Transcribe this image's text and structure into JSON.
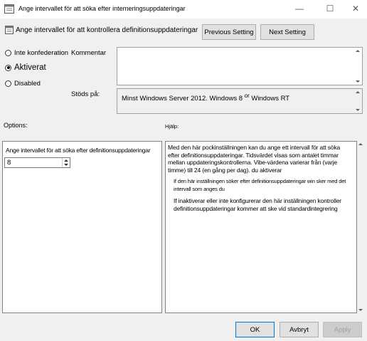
{
  "window": {
    "title": "Ange intervallet för att söka efter interneringsuppdateringar",
    "minimize": "—",
    "maximize": "☐",
    "close": "✕"
  },
  "header": {
    "setting_title": "Ange intervallet för att kontrollera definitionsuppdateringar",
    "previous_label": "Previous Setting",
    "next_label": "Next Setting"
  },
  "state": {
    "not_configured_label": "Inte konfederation",
    "enabled_label": "Aktiverat",
    "disabled_label": "Disabled",
    "selected": "enabled"
  },
  "comment": {
    "label": "Kommentar",
    "value": ""
  },
  "supported": {
    "label": "Stöds på:",
    "value_part1": "Minst Windows Server 2012. Windows 8",
    "value_or": "or",
    "value_part2": " Windows RT"
  },
  "options": {
    "label": "Options:",
    "interval_label": "Ange intervallet för att söka efter definitionsuppdateringar",
    "interval_value": "8"
  },
  "help": {
    "label": "Hjälp:",
    "p1": "Med den här pockinställningen kan du ange ett intervall för att söka efter definitionsuppdateringar. Tidsvärdet visas som antalet timmar mellan uppdateringskontrollerna. Vibe-värdena varierar från (varje timme) till 24 (en gång per dag). du aktiverar",
    "p2": "If den här inställningen söker efter definitionsuppdateringar win sker med det intervall som anges du",
    "p3": "If inaktiverar eller inte konfigurerar den här inställningen kontroller definitionsuppdateringar kommer att ske vid standardintegrering"
  },
  "footer": {
    "ok_label": "OK",
    "cancel_label": "Avbryt",
    "apply_label": "Apply"
  },
  "icons": {
    "app": "policy-icon",
    "header": "policy-icon"
  }
}
